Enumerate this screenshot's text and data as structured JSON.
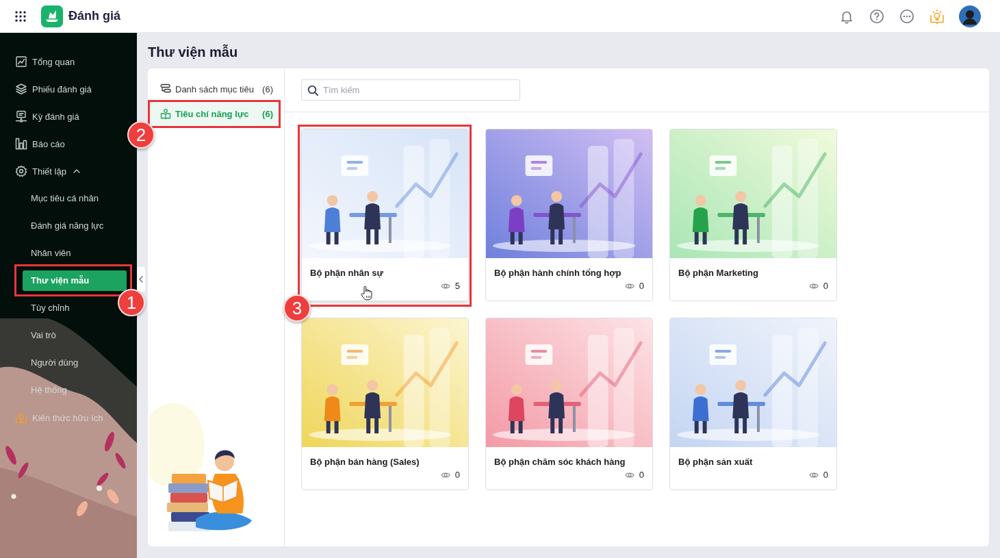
{
  "header": {
    "app_name": "Đánh giá"
  },
  "sidebar": {
    "items": [
      {
        "label": "Tổng quan",
        "selected": false
      },
      {
        "label": "Phiếu đánh giá",
        "selected": false
      },
      {
        "label": "Kỳ đánh giá",
        "selected": false
      },
      {
        "label": "Báo cáo",
        "selected": false
      },
      {
        "label": "Thiết lập",
        "selected": false,
        "expanded": true,
        "children": [
          {
            "label": "Mục tiêu cá nhân",
            "selected": false
          },
          {
            "label": "Đánh giá năng lực",
            "selected": false
          },
          {
            "label": "Nhân viên",
            "selected": false
          },
          {
            "label": "Thư viện mẫu",
            "selected": true,
            "callout": "1"
          },
          {
            "label": "Tùy chỉnh",
            "selected": false
          },
          {
            "label": "Vai trò",
            "selected": false
          },
          {
            "label": "Người dùng",
            "selected": false
          },
          {
            "label": "Hệ thống",
            "selected": false
          }
        ]
      },
      {
        "label": "Kiến thức hữu ích",
        "selected": false
      }
    ]
  },
  "page": {
    "title": "Thư viện mẫu"
  },
  "categories": [
    {
      "label": "Danh sách mục tiêu",
      "count": "(6)",
      "selected": false
    },
    {
      "label": "Tiêu chí năng lực",
      "count": "(6)",
      "selected": true,
      "callout": "2"
    }
  ],
  "search": {
    "placeholder": "Tìm kiếm"
  },
  "templates": [
    {
      "title": "Bộ phận nhân sự",
      "views": "5",
      "hovered": true,
      "callout": "3"
    },
    {
      "title": "Bộ phận hành chính tổng hợp",
      "views": "0",
      "hovered": false
    },
    {
      "title": "Bộ phận Marketing",
      "views": "0",
      "hovered": false
    },
    {
      "title": "Bộ phận bán hàng (Sales)",
      "views": "0",
      "hovered": false
    },
    {
      "title": "Bộ phận chăm sóc khách hàng",
      "views": "0",
      "hovered": false
    },
    {
      "title": "Bộ phận sản xuất",
      "views": "0",
      "hovered": false
    }
  ]
}
